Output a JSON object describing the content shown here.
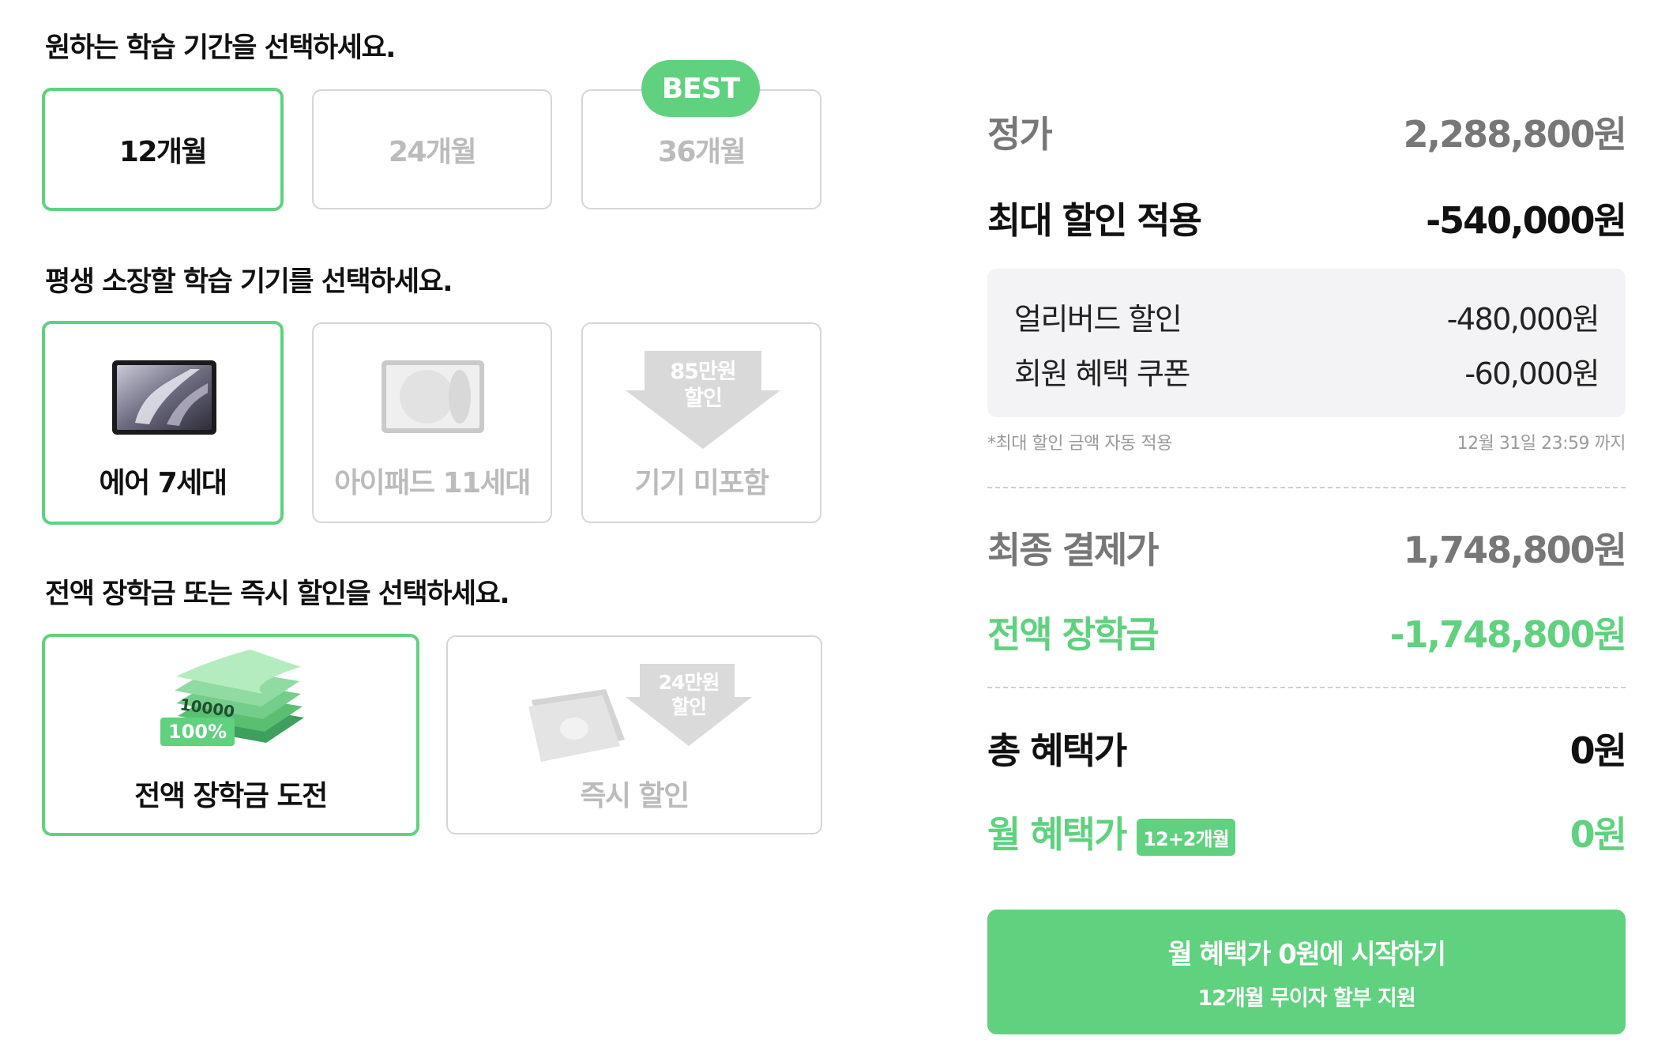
{
  "period": {
    "title": "원하는 학습 기간을 선택하세요.",
    "options": [
      {
        "label": "12개월",
        "selected": true
      },
      {
        "label": "24개월",
        "selected": false
      },
      {
        "label": "36개월",
        "selected": false
      }
    ],
    "best_tag": "BEST"
  },
  "device": {
    "title": "평생 소장할 학습 기기를 선택하세요.",
    "options": [
      {
        "label": "에어 7세대",
        "selected": true,
        "icon": "ipad-air-icon"
      },
      {
        "label": "아이패드 11세대",
        "selected": false,
        "icon": "ipad-icon"
      },
      {
        "label": "기기 미포함",
        "selected": false,
        "icon": "down-arrow-icon"
      }
    ],
    "arrow_line1": "85만원",
    "arrow_line2": "할인"
  },
  "scholarship": {
    "title": "전액 장학금 또는 즉시 할인을 선택하세요.",
    "options": [
      {
        "label": "전액 장학금 도전",
        "selected": true,
        "icon": "money-stack-icon"
      },
      {
        "label": "즉시 할인",
        "selected": false,
        "icon": "cash-discount-icon"
      }
    ],
    "money_text": "10000",
    "percent_badge": "100%",
    "arrow_line1": "24만원",
    "arrow_line2": "할인"
  },
  "summary": {
    "list_price_label": "정가",
    "list_price_value": "2,288,800원",
    "max_discount_label": "최대 할인 적용",
    "max_discount_value": "-540,000원",
    "discounts": [
      {
        "label": "얼리버드 할인",
        "value": "-480,000원"
      },
      {
        "label": "회원 혜택 쿠폰",
        "value": "-60,000원"
      }
    ],
    "note_left": "*최대 할인 금액 자동 적용",
    "note_right": "12월 31일 23:59 까지",
    "final_label": "최종 결제가",
    "final_value": "1,748,800원",
    "scholarship_label": "전액 장학금",
    "scholarship_value": "-1,748,800원",
    "total_label": "총 혜택가",
    "total_value": "0원",
    "monthly_label": "월 혜택가",
    "monthly_badge": "12+2개월",
    "monthly_value": "0원"
  },
  "cta": {
    "line1": "월 혜택가 0원에 시작하기",
    "line2": "12개월 무이자 할부 지원"
  },
  "colors": {
    "accent": "#5fd17f",
    "border": "#d6d6d6",
    "muted": "#bbbbbb"
  }
}
